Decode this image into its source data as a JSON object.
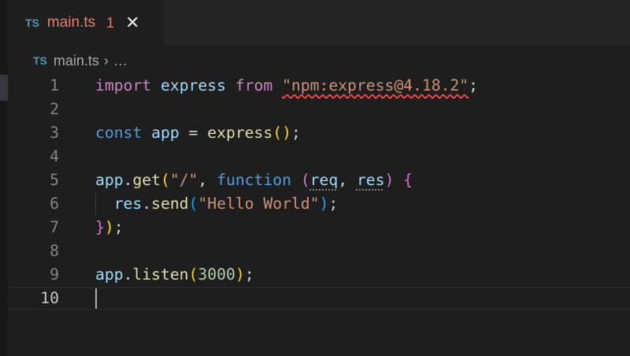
{
  "tab": {
    "icon": "TS",
    "name": "main.ts",
    "problems": "1",
    "close": "✕"
  },
  "breadcrumb": {
    "icon": "TS",
    "file": "main.ts",
    "separator": "›",
    "more": "…"
  },
  "editor": {
    "current_line": 10,
    "lines": [
      {
        "n": "1",
        "tokens": [
          [
            "import ",
            "k"
          ],
          [
            "express ",
            "v"
          ],
          [
            "from ",
            "k"
          ],
          [
            "\"npm:express@4.18.2\"",
            "s squig"
          ],
          [
            ";",
            "p"
          ]
        ]
      },
      {
        "n": "2",
        "tokens": []
      },
      {
        "n": "3",
        "tokens": [
          [
            "const ",
            "fn"
          ],
          [
            "app ",
            "v"
          ],
          [
            "= ",
            "p"
          ],
          [
            "express",
            "f"
          ],
          [
            "()",
            "y"
          ],
          [
            ";",
            "p"
          ]
        ]
      },
      {
        "n": "4",
        "tokens": []
      },
      {
        "n": "5",
        "tokens": [
          [
            "app",
            "v"
          ],
          [
            ".",
            "p"
          ],
          [
            "get",
            "f"
          ],
          [
            "(",
            "y"
          ],
          [
            "\"/\"",
            "s"
          ],
          [
            ", ",
            "p"
          ],
          [
            "function ",
            "fn"
          ],
          [
            "(",
            "m"
          ],
          [
            "req",
            "v dots"
          ],
          [
            ", ",
            "p"
          ],
          [
            "res",
            "v dots"
          ],
          [
            ") ",
            "m"
          ],
          [
            "{",
            "m"
          ]
        ]
      },
      {
        "n": "6",
        "tokens": [
          [
            "  res",
            "v"
          ],
          [
            ".",
            "p"
          ],
          [
            "send",
            "f"
          ],
          [
            "(",
            "b"
          ],
          [
            "\"Hello World\"",
            "s"
          ],
          [
            ")",
            "b"
          ],
          [
            ";",
            "p"
          ]
        ],
        "guide": true
      },
      {
        "n": "7",
        "tokens": [
          [
            "}",
            "m"
          ],
          [
            ")",
            "y"
          ],
          [
            ";",
            "p"
          ]
        ]
      },
      {
        "n": "8",
        "tokens": []
      },
      {
        "n": "9",
        "tokens": [
          [
            "app",
            "v"
          ],
          [
            ".",
            "p"
          ],
          [
            "listen",
            "f"
          ],
          [
            "(",
            "y"
          ],
          [
            "3000",
            "n"
          ],
          [
            ")",
            "y"
          ],
          [
            ";",
            "p"
          ]
        ]
      },
      {
        "n": "10",
        "tokens": []
      }
    ]
  }
}
